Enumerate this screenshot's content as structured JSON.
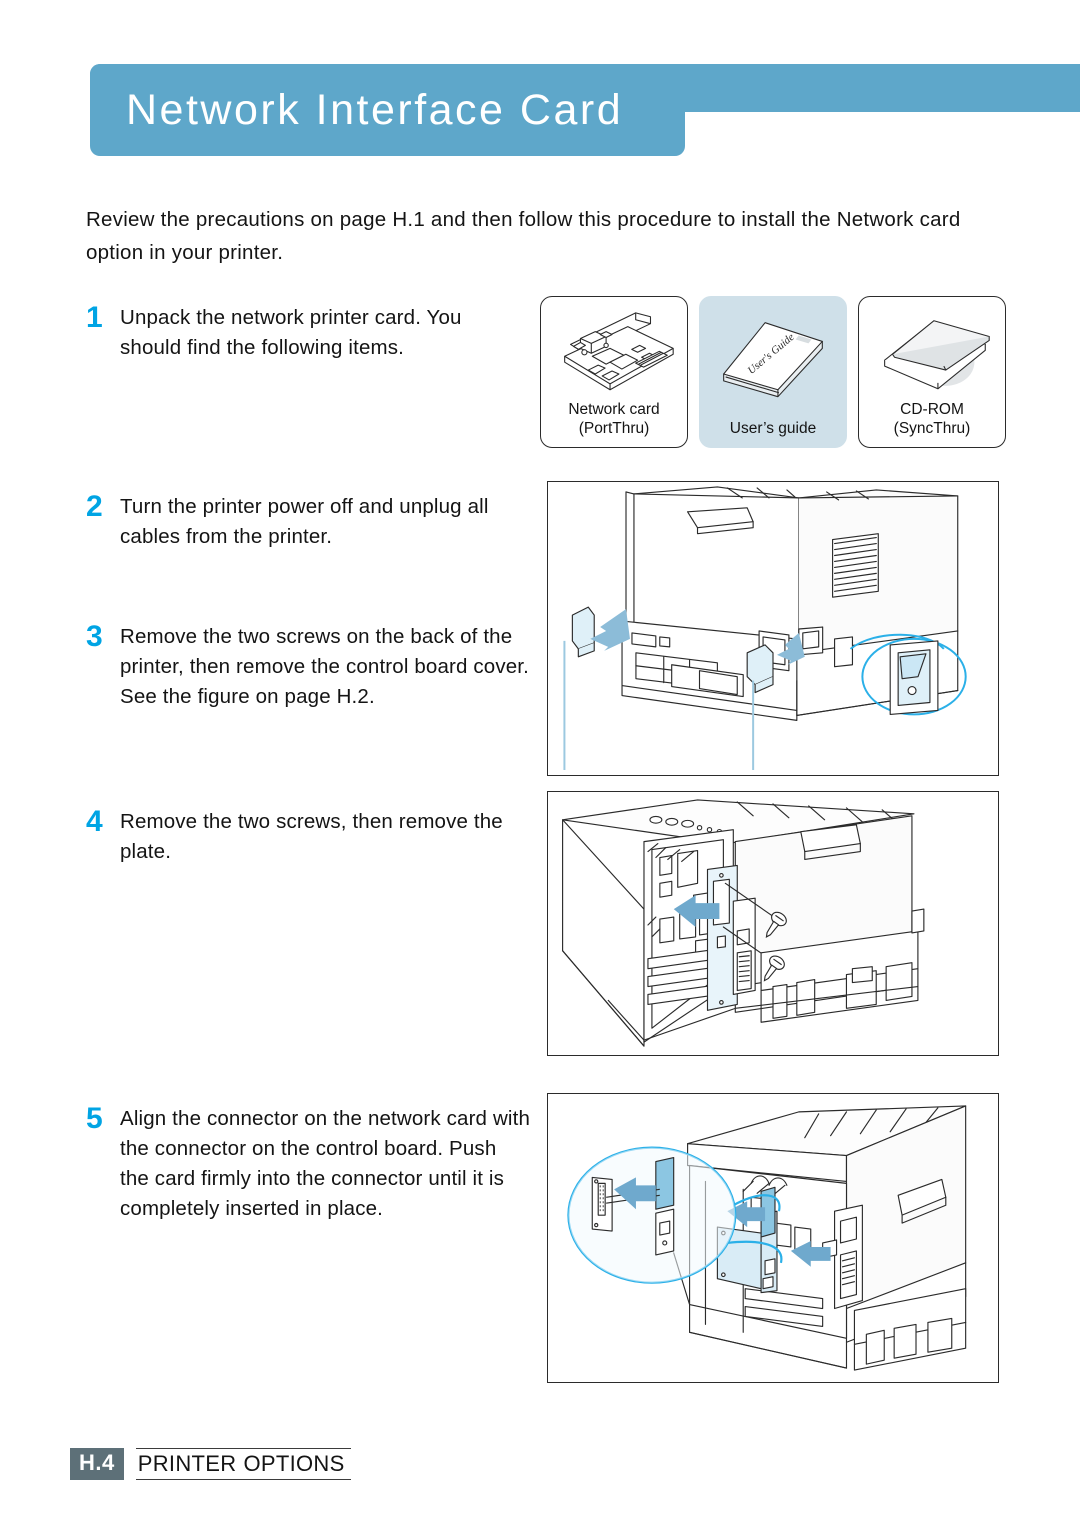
{
  "header": {
    "title": "Network Interface Card",
    "accent_color": "#5ea7ca"
  },
  "intro": "Review the precautions on page H.1 and then follow this procedure to install the Network card option in your printer.",
  "steps": [
    {
      "num": "1",
      "text": "Unpack the network printer card. You should find the following items."
    },
    {
      "num": "2",
      "text": "Turn the printer power off and unplug all cables from the printer."
    },
    {
      "num": "3",
      "text": "Remove the two screws on the back of the printer, then remove the control board cover. See the figure on page H.2."
    },
    {
      "num": "4",
      "text": "Remove the two screws, then remove the plate."
    },
    {
      "num": "5",
      "text": "Align the connector on the network card with the connector on the control board. Push the card firmly into the connector until it is completely inserted in place."
    }
  ],
  "items": [
    {
      "line1": "Network card",
      "line2": "(PortThru)",
      "art": "network-card-illustration",
      "tinted": false
    },
    {
      "line1": "User’s guide",
      "line2": "",
      "art": "users-guide-booklet-illustration",
      "tinted": true
    },
    {
      "line1": "CD-ROM",
      "line2": "(SyncThru)",
      "art": "cd-rom-sleeve-illustration",
      "tinted": false
    }
  ],
  "booklet_label": "User's Guide",
  "figures": [
    {
      "id": "fig2",
      "caption": "printer-rear-cables-unplug-illustration"
    },
    {
      "id": "fig4",
      "caption": "control-board-plate-screws-illustration"
    },
    {
      "id": "fig5",
      "caption": "network-card-insert-connector-illustration"
    }
  ],
  "footer": {
    "page_number": "H.4",
    "section_first": "P",
    "section_rest": "RINTER",
    "section2_first": "O",
    "section2_rest": "PTIONS",
    "box_color": "#5d7078"
  },
  "colors": {
    "step_number": "#00a4e4",
    "banner": "#5ea7ca",
    "tint": "#cfe0e9",
    "line_art": "#2b2b2b",
    "arrow_blue": "#7fb8d8"
  }
}
